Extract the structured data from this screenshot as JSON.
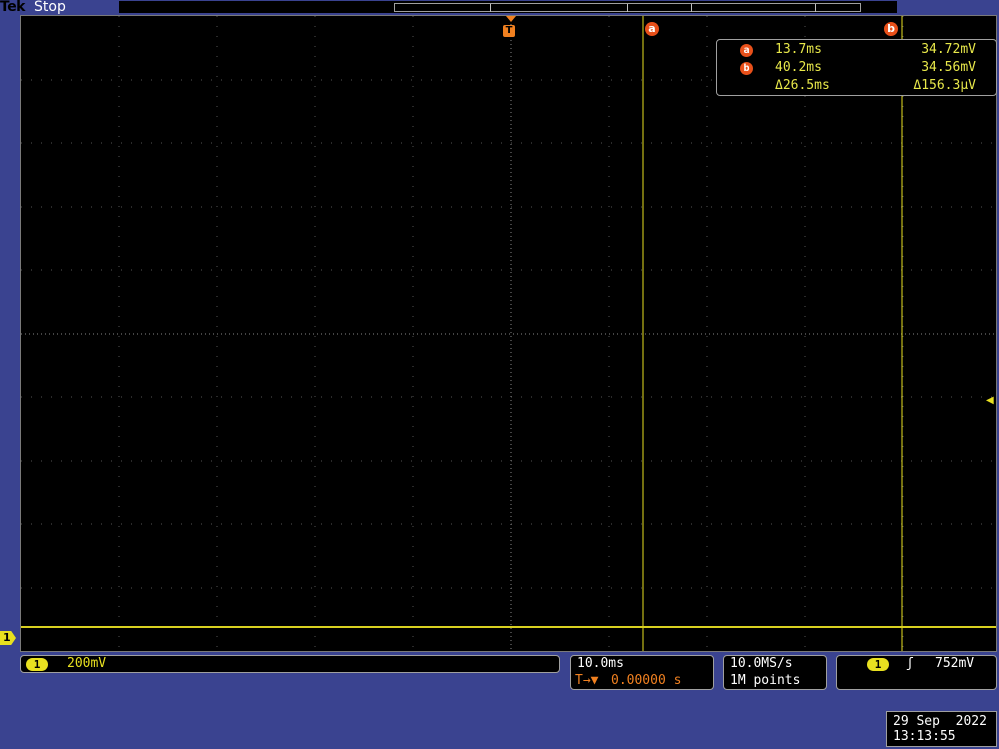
{
  "header": {
    "brand": "Tek",
    "acq_status": "Stop"
  },
  "markers": {
    "trigger_label": "T",
    "cursor_a_label": "a",
    "cursor_b_label": "b",
    "channel_label": "1"
  },
  "cursor_readout": {
    "a_time": "13.7ms",
    "a_volt": "34.72mV",
    "b_time": "40.2ms",
    "b_volt": "34.56mV",
    "delta_time": "Δ26.5ms",
    "delta_volt": "Δ156.3µV"
  },
  "vertical": {
    "channel": "1",
    "scale": "200mV"
  },
  "horizontal": {
    "scale": "10.0ms",
    "trigger_pos_icon": "T→▼",
    "delay": "0.00000 s"
  },
  "acquisition": {
    "sample_rate": "10.0MS/s",
    "record_length": "1M points"
  },
  "trigger": {
    "channel": "1",
    "slope_icon": "rising-edge-icon",
    "slope_glyph": "ʃ",
    "level": "752mV"
  },
  "datetime": {
    "date": "29 Sep  2022",
    "time": "13:13:55"
  },
  "colors": {
    "background": "#3a4390",
    "screen": "#000000",
    "trace": "#e8e020",
    "cursor_marker": "#e8501a",
    "trigger": "#f08020"
  }
}
